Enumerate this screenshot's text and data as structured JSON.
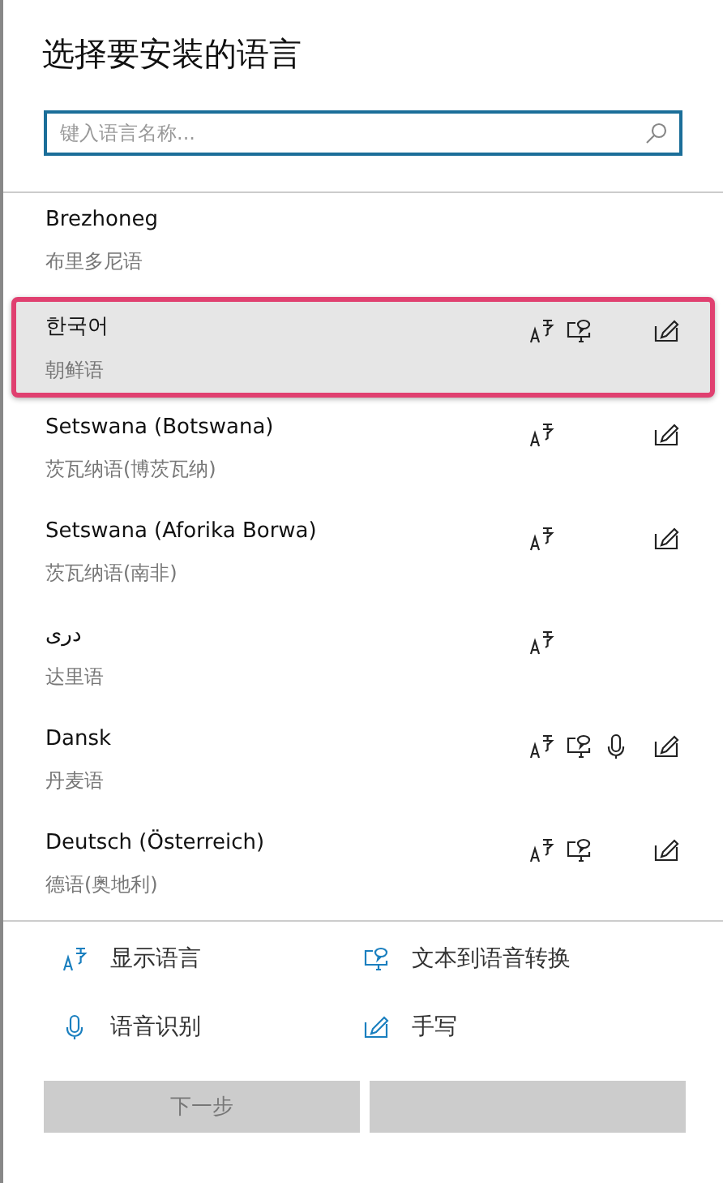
{
  "title": "选择要安装的语言",
  "search": {
    "placeholder": "键入语言名称..."
  },
  "languages": [
    {
      "name": "Brezhoneg",
      "translation": "布里多尼语",
      "selected": false,
      "display": false,
      "tts": false,
      "speech": false,
      "handwriting": false
    },
    {
      "name": "한국어",
      "translation": "朝鲜语",
      "selected": true,
      "display": true,
      "tts": true,
      "speech": false,
      "handwriting": true
    },
    {
      "name": "Setswana (Botswana)",
      "translation": "茨瓦纳语(博茨瓦纳)",
      "selected": false,
      "display": true,
      "tts": false,
      "speech": false,
      "handwriting": true
    },
    {
      "name": "Setswana (Aforika Borwa)",
      "translation": "茨瓦纳语(南非)",
      "selected": false,
      "display": true,
      "tts": false,
      "speech": false,
      "handwriting": true
    },
    {
      "name": "دری",
      "translation": "达里语",
      "selected": false,
      "display": true,
      "tts": false,
      "speech": false,
      "handwriting": false
    },
    {
      "name": "Dansk",
      "translation": "丹麦语",
      "selected": false,
      "display": true,
      "tts": true,
      "speech": true,
      "handwriting": true
    },
    {
      "name": "Deutsch (Österreich)",
      "translation": "德语(奥地利)",
      "selected": false,
      "display": true,
      "tts": true,
      "speech": false,
      "handwriting": true
    }
  ],
  "legend": [
    {
      "kind": "display",
      "label": "显示语言"
    },
    {
      "kind": "tts",
      "label": "文本到语音转换"
    },
    {
      "kind": "speech",
      "label": "语音识别"
    },
    {
      "kind": "handwriting",
      "label": "手写"
    }
  ],
  "buttons": [
    {
      "label": "下一步",
      "disabled": true
    },
    {
      "disabled": true
    }
  ]
}
